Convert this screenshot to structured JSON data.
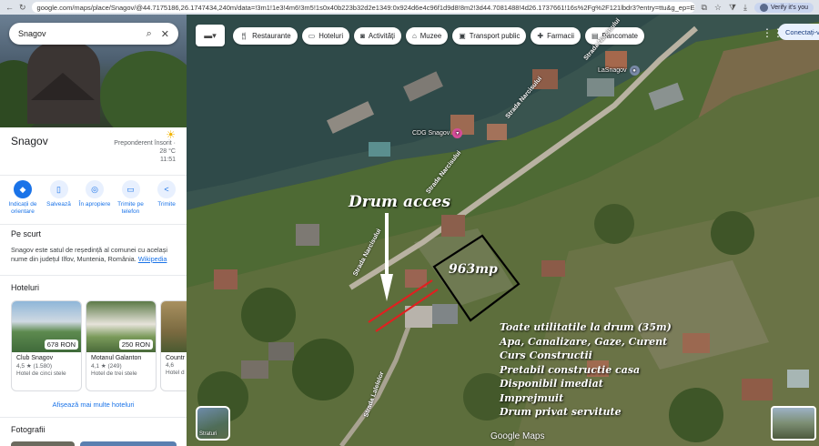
{
  "browser": {
    "url": "google.com/maps/place/Snagov/@44.7175186,26.1747434,240m/data=!3m1!1e3!4m6!3m5!1s0x40b223b32d2e1349:0x924d6e4c96f1d9d8!8m2!3d44.7081488!4d26.1737661!16s%2Fg%2F121lbdr3?entry=ttu&g_ep=EgoyMDI2MD",
    "verify_label": "Verify it's you"
  },
  "search": {
    "value": "Snagov"
  },
  "place": {
    "title": "Snagov",
    "weather_desc": "Preponderent însorit ·",
    "temperature": "28 °C",
    "time": "11:51"
  },
  "actions": [
    {
      "label": "Indicații de orientare",
      "icon": "directions-icon"
    },
    {
      "label": "Salvează",
      "icon": "bookmark-icon"
    },
    {
      "label": "În apropiere",
      "icon": "nearby-icon"
    },
    {
      "label": "Trimite pe telefon",
      "icon": "phone-icon"
    },
    {
      "label": "Trimite",
      "icon": "share-icon"
    }
  ],
  "about": {
    "title": "Pe scurt",
    "text": "Snagov este satul de reședință al comunei cu același nume din județul Ilfov, Muntenia, România.",
    "link": "Wikipedia"
  },
  "hotels": {
    "title": "Hoteluri",
    "items": [
      {
        "name": "Club Snagov",
        "price": "678 RON",
        "rating": "4,5 ★ (1.580)",
        "type": "Hotel de cinci stele"
      },
      {
        "name": "Motanul Galanton",
        "price": "250 RON",
        "rating": "4,1 ★ (249)",
        "type": "Hotel de trei stele"
      },
      {
        "name": "Countr",
        "price": "",
        "rating": "4,6",
        "type": "Hotel d"
      }
    ],
    "more_label": "Afișează mai multe hoteluri"
  },
  "photos": {
    "title": "Fotografii"
  },
  "map": {
    "chips": [
      {
        "label": "Restaurante",
        "icon": "fork-knife-icon"
      },
      {
        "label": "Hoteluri",
        "icon": "bed-icon"
      },
      {
        "label": "Activități",
        "icon": "camera-icon"
      },
      {
        "label": "Muzee",
        "icon": "museum-icon"
      },
      {
        "label": "Transport public",
        "icon": "bus-icon"
      },
      {
        "label": "Farmacii",
        "icon": "pharmacy-icon"
      },
      {
        "label": "Bancomate",
        "icon": "atm-icon"
      }
    ],
    "signin_label": "Conectați-v",
    "overlay": {
      "drum_acces": "Drum acces",
      "area": "963mp",
      "info_lines": [
        "Toate utilitatile la drum (35m)",
        "Apa, Canalizare, Gaze, Curent",
        "Curs Constructii",
        "Pretabil constructie casa",
        "Disponibil imediat",
        "Imprejmuit",
        "Drum privat servitute"
      ]
    },
    "streets": {
      "narcisului_1": "Strada Narcisului",
      "narcisului_2": "Strada Narcisului",
      "narcisului_3": "Strada Narcisului",
      "narcisului_4": "Strada Narcisului",
      "lalelelor": "Strada Lalelelor"
    },
    "pois": {
      "lasnagov": "LaSnagov",
      "cdg": "CDG Snagov"
    },
    "layers_label": "Straturi",
    "google_logo": "Google Maps",
    "colors": {
      "accent": "#1a73e8",
      "plot_outline": "#000000",
      "access_line": "#e02020"
    }
  }
}
